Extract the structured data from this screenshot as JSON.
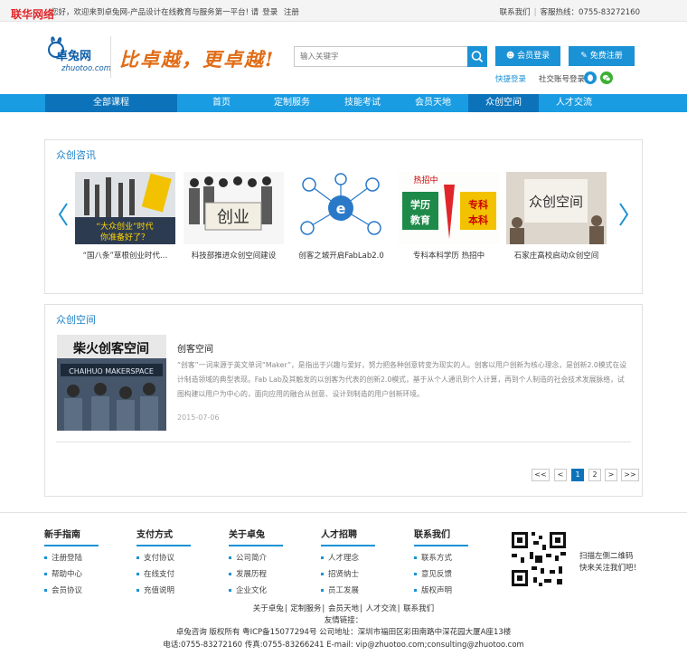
{
  "watermark": "联华网络",
  "topbar": {
    "welcome": "您好，欢迎来到卓兔网-产品设计在线教育与服务第一平台! 请",
    "login": "登录",
    "register": "注册",
    "contact": "联系我们",
    "hotline": "客服热线：0755-83272160"
  },
  "header": {
    "logo_title": "卓兔网",
    "logo_sub": "zhuotoo.com",
    "slogan": "比卓越，更卓越!",
    "search_placeholder": "输入关键字",
    "member_login": "会员登录",
    "free_register": "免费注册",
    "quick_login": "快捷登录",
    "social_login": "社交账号登录"
  },
  "nav": {
    "all": "全部课程",
    "items": [
      "首页",
      "定制服务",
      "技能考试",
      "会员天地",
      "众创空间",
      "人才交流"
    ]
  },
  "news": {
    "title": "众创咨讯",
    "items": [
      {
        "caption": "“国八条”草根创业时代…"
      },
      {
        "caption": "科技部推进众创空间建设"
      },
      {
        "caption": "创客之城开启FabLab2.0"
      },
      {
        "caption": "专科本科学历 热招中"
      },
      {
        "caption": "石家庄高校启动众创空间"
      }
    ],
    "img1_text": [
      "“大众创业”时代",
      "你准备好了？"
    ],
    "img2_text": "创业",
    "img4_text": [
      "热招中",
      "学历",
      "教育",
      "专科",
      "本科"
    ],
    "img5_text": "众创空间"
  },
  "space": {
    "title": "众创空间",
    "img_text": [
      "柴火创客空间",
      "CHAIHUO MAKERSPACE"
    ],
    "article_title": "创客空间",
    "article_body": "“创客”一词来源于英文单词“Maker”，是指出于兴趣与爱好，努力把各种创意转变为现实的人。创客以用户创新为核心理念，是创新2.0模式在设计制造领域的典型表现。Fab Lab及其触发的以创客为代表的创新2.0模式，基于从个人通讯到个人计算，再到个人制造的社会技术发展脉络，试图构建以用户为中心的，面向应用的融合从创意、设计到制造的用户创新环境。",
    "date": "2015-07-06",
    "pager": [
      "<<",
      "<",
      "1",
      "2",
      ">",
      ">>"
    ]
  },
  "footer": {
    "cols": [
      {
        "title": "新手指南",
        "items": [
          "注册登陆",
          "帮助中心",
          "会员协议"
        ]
      },
      {
        "title": "支付方式",
        "items": [
          "支付协议",
          "在线支付",
          "充值说明"
        ]
      },
      {
        "title": "关于卓兔",
        "items": [
          "公司简介",
          "发展历程",
          "企业文化"
        ]
      },
      {
        "title": "人才招聘",
        "items": [
          "人才理念",
          "招贤纳士",
          "员工发展"
        ]
      },
      {
        "title": "联系我们",
        "items": [
          "联系方式",
          "意见反馈",
          "版权声明"
        ]
      }
    ],
    "qr_line1": "扫描左侧二维码",
    "qr_line2": "快来关注我们吧！",
    "links": [
      "关于卓兔",
      "定制服务",
      "会员天地",
      "人才交流",
      "联系我们"
    ],
    "friend_links": "友情链接：",
    "copyright": "卓兔咨询   版权所有  粤ICP备15077294号   公司地址：深圳市福田区彩田南路中深花园大厦A座13楼",
    "contact_line": "电话:0755-83272160  传真:0755-83266241  E-mail: vip@zhuotoo.com;consulting@zhuotoo.com"
  },
  "colors": {
    "accent": "#1b92d6",
    "nav": "#199ce2",
    "nav_active": "#0c73ba",
    "slogan": "#e06c16",
    "watermark": "#e0262a"
  }
}
